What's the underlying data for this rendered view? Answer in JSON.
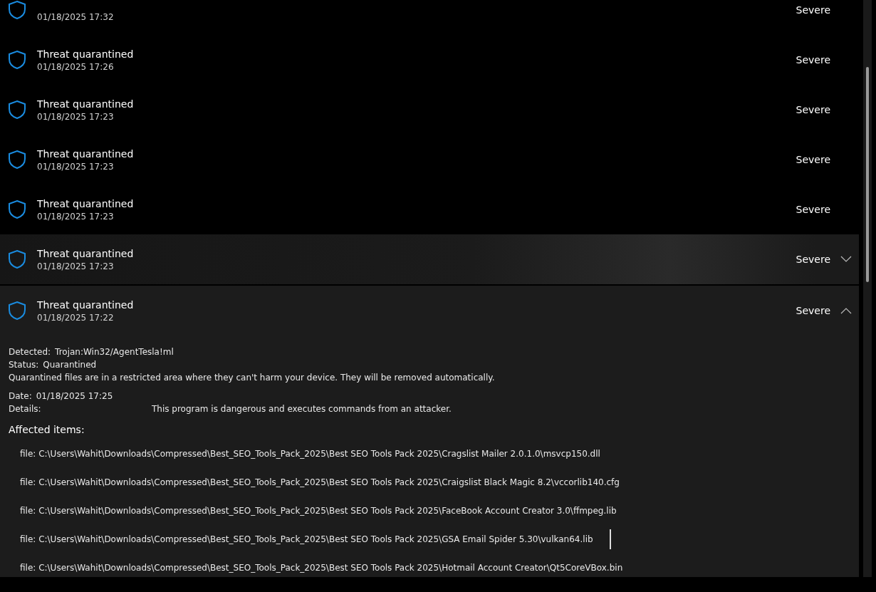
{
  "history": [
    {
      "date": "01/18/2025 17:32",
      "severity": "Severe",
      "hovered": false,
      "expanded": false
    },
    {
      "title": "Threat quarantined",
      "date": "01/18/2025 17:26",
      "severity": "Severe",
      "hovered": false,
      "expanded": false
    },
    {
      "title": "Threat quarantined",
      "date": "01/18/2025 17:23",
      "severity": "Severe",
      "hovered": false,
      "expanded": false
    },
    {
      "title": "Threat quarantined",
      "date": "01/18/2025 17:23",
      "severity": "Severe",
      "hovered": false,
      "expanded": false
    },
    {
      "title": "Threat quarantined",
      "date": "01/18/2025 17:23",
      "severity": "Severe",
      "hovered": false,
      "expanded": false
    },
    {
      "title": "Threat quarantined",
      "date": "01/18/2025 17:23",
      "severity": "Severe",
      "hovered": true,
      "expanded": false
    },
    {
      "title": "Threat quarantined",
      "date": "01/18/2025 17:22",
      "severity": "Severe",
      "hovered": false,
      "expanded": true,
      "details": {
        "detected_label": "Detected:",
        "detected": "Trojan:Win32/AgentTesla!ml",
        "status_label": "Status:",
        "status": "Quarantined",
        "note": "Quarantined files are in a restricted area where they can't harm your device. They will be removed automatically.",
        "date_label": "Date:",
        "date": "01/18/2025 17:25",
        "details_label": "Details:",
        "description": "This program is dangerous and executes commands from an attacker.",
        "affected_heading": "Affected items:",
        "affected_items": [
          "file: C:\\Users\\Wahit\\Downloads\\Compressed\\Best_SEO_Tools_Pack_2025\\Best SEO Tools Pack 2025\\Cragslist Mailer 2.0.1.0\\msvcp150.dll",
          "file: C:\\Users\\Wahit\\Downloads\\Compressed\\Best_SEO_Tools_Pack_2025\\Best SEO Tools Pack 2025\\Craigslist Black Magic 8.2\\vccorlib140.cfg",
          "file: C:\\Users\\Wahit\\Downloads\\Compressed\\Best_SEO_Tools_Pack_2025\\Best SEO Tools Pack 2025\\FaceBook Account Creator 3.0\\ffmpeg.lib",
          "file: C:\\Users\\Wahit\\Downloads\\Compressed\\Best_SEO_Tools_Pack_2025\\Best SEO Tools Pack 2025\\GSA Email Spider 5.30\\vulkan64.lib",
          "file: C:\\Users\\Wahit\\Downloads\\Compressed\\Best_SEO_Tools_Pack_2025\\Best SEO Tools Pack 2025\\Hotmail Account Creator\\Qt5CoreVBox.bin"
        ]
      }
    }
  ]
}
